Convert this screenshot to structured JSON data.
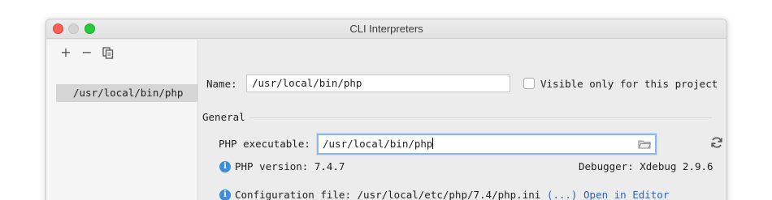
{
  "window": {
    "title": "CLI Interpreters"
  },
  "toolbar": {
    "add_icon": "plus-icon",
    "remove_icon": "minus-icon",
    "copy_icon": "copy-icon",
    "add_glyph": "+",
    "remove_glyph": "−"
  },
  "interpreters": [
    {
      "label": "/usr/local/bin/php",
      "selected": true
    }
  ],
  "form": {
    "name_label": "Name:",
    "name_value": "/usr/local/bin/php",
    "visible_only_label": "Visible only for this project",
    "visible_only_checked": false,
    "general_label": "General",
    "php_executable_label": "PHP executable:",
    "php_executable_value": "/usr/local/bin/php",
    "php_version_text": "PHP version: 7.4.7",
    "debugger_text": "Debugger: Xdebug 2.9.6",
    "config_text": "Configuration file: /usr/local/etc/php/7.4/php.ini",
    "config_more_link": "(...)",
    "open_in_editor_link": "Open in Editor"
  },
  "colors": {
    "accent": "#3d8ddb",
    "link": "#2e63b8",
    "focus_ring": "#8fb7ea",
    "close": "#fd5f57",
    "maximize": "#28c840"
  }
}
